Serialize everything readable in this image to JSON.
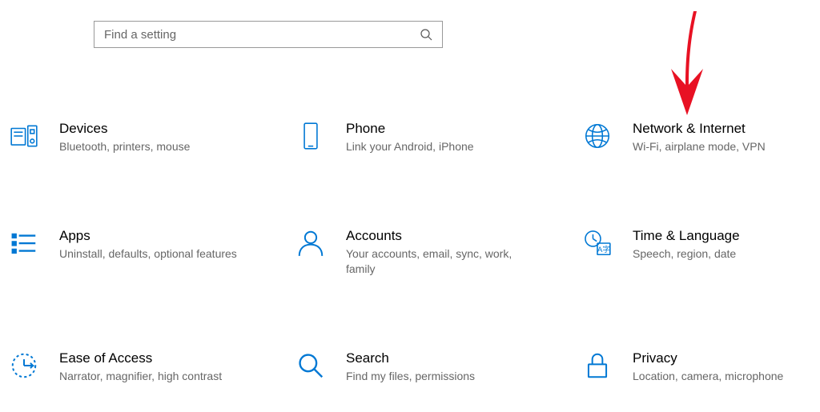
{
  "search": {
    "placeholder": "Find a setting"
  },
  "tiles": {
    "devices": {
      "title": "Devices",
      "desc": "Bluetooth, printers, mouse"
    },
    "phone": {
      "title": "Phone",
      "desc": "Link your Android, iPhone"
    },
    "network": {
      "title": "Network & Internet",
      "desc": "Wi-Fi, airplane mode, VPN"
    },
    "apps": {
      "title": "Apps",
      "desc": "Uninstall, defaults, optional features"
    },
    "accounts": {
      "title": "Accounts",
      "desc": "Your accounts, email, sync, work, family"
    },
    "time": {
      "title": "Time & Language",
      "desc": "Speech, region, date"
    },
    "ease": {
      "title": "Ease of Access",
      "desc": "Narrator, magnifier, high contrast"
    },
    "search": {
      "title": "Search",
      "desc": "Find my files, permissions"
    },
    "privacy": {
      "title": "Privacy",
      "desc": "Location, camera, microphone"
    }
  }
}
